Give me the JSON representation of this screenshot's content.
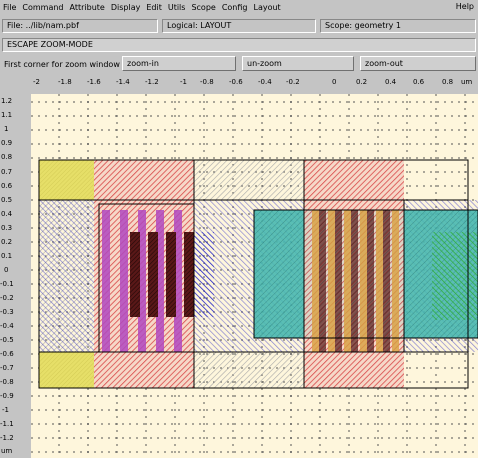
{
  "menu": {
    "items": [
      "File",
      "Command",
      "Attribute",
      "Display",
      "Edit",
      "Utils",
      "Scope",
      "Config",
      "Layout"
    ],
    "help": "Help"
  },
  "status": {
    "file": "File: ../lib/nam.pbf",
    "logical": "Logical: LAYOUT",
    "scope": "Scope: geometry  1"
  },
  "mode": "ESCAPE  ZOOM-MODE",
  "prompt": "First corner for zoom window",
  "buttons": {
    "zoom_in": "zoom-in",
    "un_zoom": "un-zoom",
    "zoom_out": "zoom-out"
  },
  "ruler": {
    "x_ticks": [
      "-2",
      "-1.8",
      "-1.6",
      "-1.4",
      "-1.2",
      "-1",
      "-0.8",
      "-0.6",
      "-0.4",
      "-0.2",
      "0",
      "0.2",
      "0.4",
      "0.6",
      "0.8",
      "um"
    ],
    "y_ticks": [
      "1.2",
      "1.1",
      "1",
      "0.9",
      "0.8",
      "0.7",
      "0.6",
      "0.5",
      "0.4",
      "0.3",
      "0.2",
      "0.1",
      "0",
      "-0.1",
      "-0.2",
      "-0.3",
      "-0.4",
      "-0.5",
      "-0.6",
      "-0.7",
      "-0.8",
      "-0.9",
      "-1",
      "-1.1",
      "-1.2",
      "um"
    ]
  },
  "colors": {
    "background": "#fef6dc",
    "grid": "#505050",
    "yellow": "#e8e060",
    "red_hatch": "#e05858",
    "blue_hatch": "#3030d0",
    "magenta": "#b050c0",
    "dark_red": "#401818",
    "teal": "#40b8b0",
    "green_hatch": "#40c040",
    "outline": "#000000"
  }
}
